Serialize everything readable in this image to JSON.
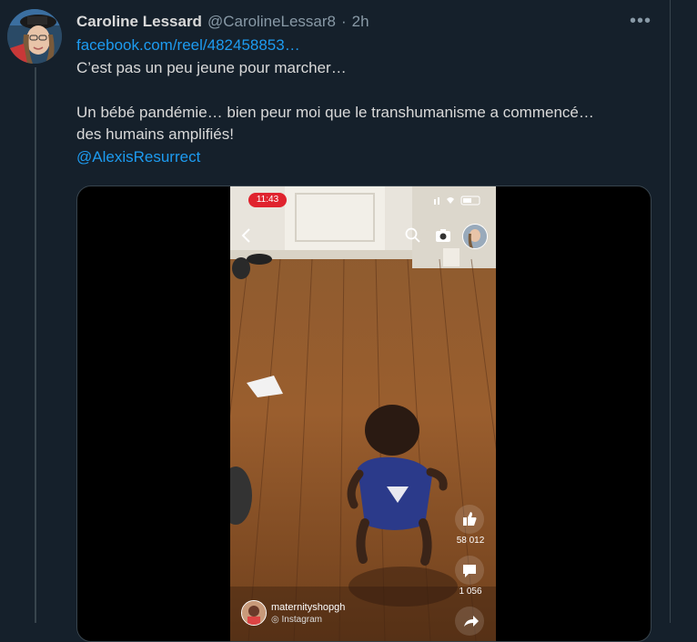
{
  "tweet": {
    "display_name": "Caroline Lessard",
    "handle": "@CarolineLessar8",
    "separator": "·",
    "time": "2h",
    "more_label": "•••",
    "link": "facebook.com/reel/482458853…",
    "line1": "C’est pas un peu jeune pour marcher…",
    "line2": "Un bébé pandémie… bien peur moi que le transhumanisme a commencé…",
    "line3": "des humains amplifiés!",
    "mention": "@AlexisResurrect"
  },
  "video": {
    "status_time": "11:43",
    "likes_count": "58 012",
    "comments_count": "1 056",
    "owner_name": "maternityshopgh",
    "owner_sub": "Instagram"
  },
  "colors": {
    "background": "#15202b",
    "border": "#38444d",
    "text": "#d9d9d9",
    "muted": "#8899a6",
    "link": "#1d9bf0",
    "record_red": "#e0232e"
  },
  "icons": [
    "more-icon",
    "back-arrow-icon",
    "search-icon",
    "camera-icon",
    "like-icon",
    "comment-icon",
    "share-icon",
    "wifi-icon",
    "battery-icon"
  ]
}
